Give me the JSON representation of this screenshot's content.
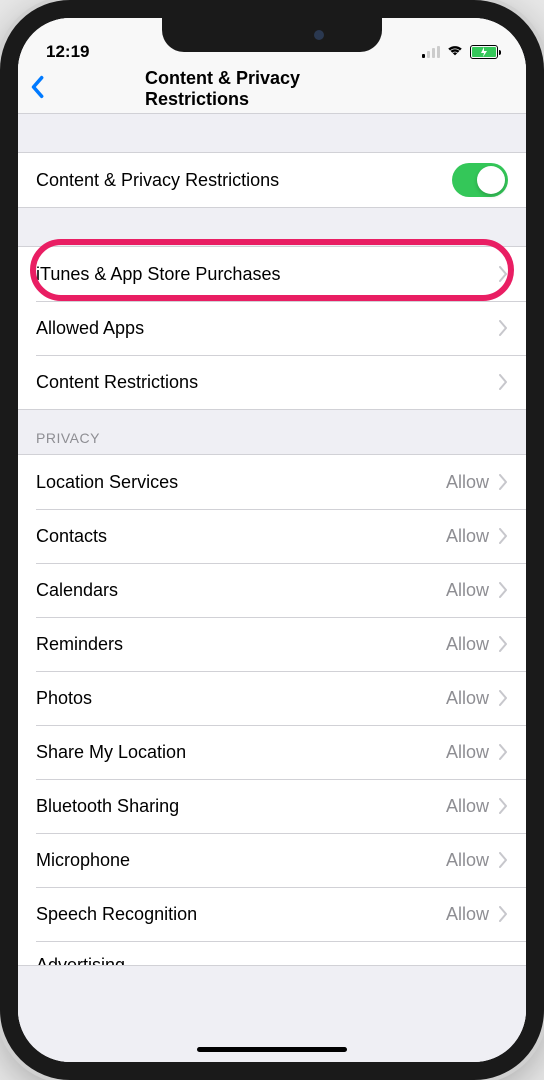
{
  "statusBar": {
    "time": "12:19"
  },
  "nav": {
    "title": "Content & Privacy Restrictions"
  },
  "mainToggle": {
    "label": "Content & Privacy Restrictions",
    "on": true
  },
  "restrictionRows": [
    {
      "label": "iTunes & App Store Purchases"
    },
    {
      "label": "Allowed Apps"
    },
    {
      "label": "Content Restrictions"
    }
  ],
  "privacyHeader": "PRIVACY",
  "privacyRows": [
    {
      "label": "Location Services",
      "value": "Allow"
    },
    {
      "label": "Contacts",
      "value": "Allow"
    },
    {
      "label": "Calendars",
      "value": "Allow"
    },
    {
      "label": "Reminders",
      "value": "Allow"
    },
    {
      "label": "Photos",
      "value": "Allow"
    },
    {
      "label": "Share My Location",
      "value": "Allow"
    },
    {
      "label": "Bluetooth Sharing",
      "value": "Allow"
    },
    {
      "label": "Microphone",
      "value": "Allow"
    },
    {
      "label": "Speech Recognition",
      "value": "Allow"
    },
    {
      "label": "Advertising",
      "value": ""
    }
  ]
}
